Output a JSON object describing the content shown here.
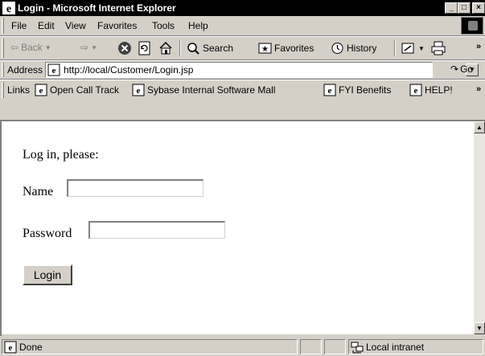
{
  "window": {
    "title": "Login - Microsoft Internet Explorer",
    "min_glyph": "_",
    "max_glyph": "□",
    "close_glyph": "×"
  },
  "menu": {
    "items": [
      "File",
      "Edit",
      "View",
      "Favorites",
      "Tools",
      "Help"
    ]
  },
  "toolbar": {
    "back_label": "Back",
    "search_label": "Search",
    "favorites_label": "Favorites",
    "history_label": "History",
    "more_glyph": "»"
  },
  "address": {
    "label": "Address",
    "url": "http://local/Customer/Login.jsp",
    "go_label": "Go"
  },
  "links": {
    "label": "Links",
    "items": [
      "Open Call Track",
      "Sybase Internal Software Mall",
      "FYI Benefits",
      "HELP!"
    ],
    "more_glyph": "»"
  },
  "page": {
    "prompt": "Log in, please:",
    "name_label": "Name",
    "name_value": "",
    "password_label": "Password",
    "password_value": "",
    "login_button": "Login"
  },
  "status": {
    "text": "Done",
    "zone": "Local intranet"
  },
  "colors": {
    "chrome": "#d4d0c8",
    "titlebar": "#000000",
    "content_bg": "#ffffff"
  }
}
